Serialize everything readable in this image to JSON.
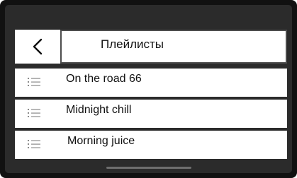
{
  "header": {
    "back_icon": "chevron-left-icon",
    "title": "Плейлисты"
  },
  "playlists": [
    {
      "icon": "list-icon",
      "label": "On the road 66"
    },
    {
      "icon": "list-icon",
      "label": "Midnight chill"
    },
    {
      "icon": "list-icon",
      "label": "Morning juice"
    }
  ],
  "colors": {
    "bezel": "#111111",
    "screen_background": "#2b2b2b",
    "tile": "#ffffff",
    "text": "#111111",
    "icon": "#8a8a8a"
  }
}
